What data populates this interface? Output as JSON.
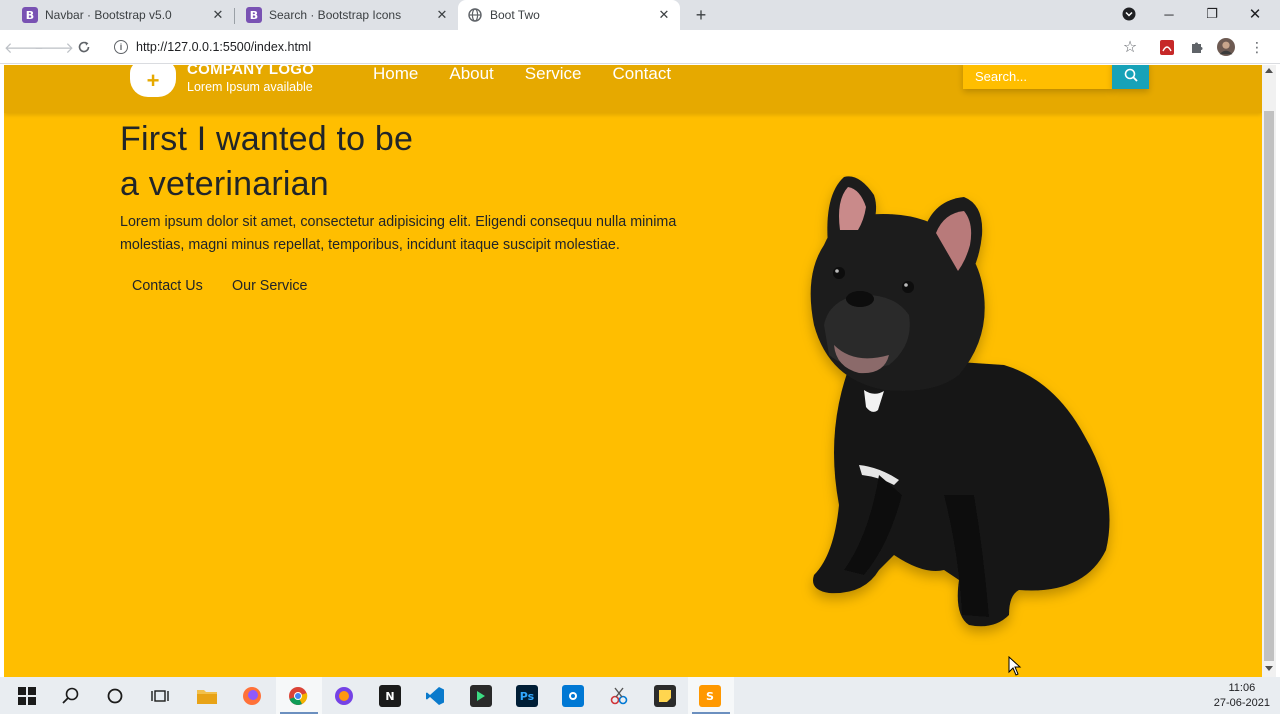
{
  "browser": {
    "tabs": [
      {
        "favicon": "B",
        "title": "Navbar · Bootstrap v5.0"
      },
      {
        "favicon": "B",
        "title": "Search · Bootstrap Icons"
      },
      {
        "favicon": "globe-icon",
        "title": "Boot Two"
      }
    ],
    "url": "http://127.0.0.1:5500/index.html"
  },
  "page": {
    "logo": {
      "title": "COMPANY LOGO",
      "subtitle": "Lorem Ipsum available"
    },
    "nav": [
      "Home",
      "About",
      "Service",
      "Contact"
    ],
    "search_placeholder": "Search...",
    "hero": {
      "title_line1": "First I wanted to be",
      "title_line2": "a veterinarian",
      "text": "Lorem ipsum dolor sit amet, consectetur adipisicing elit. Eligendi consequu nulla minima molestias, magni minus repellat, temporibus, incidunt itaque suscipit molestiae.",
      "buttons": [
        "Contact Us",
        "Our Service"
      ]
    },
    "colors": {
      "background": "#ffbe00",
      "navbar": "#e6a900",
      "search_button": "#17a2b8"
    }
  },
  "taskbar": {
    "time": "11:06",
    "date": "27-06-2021"
  }
}
